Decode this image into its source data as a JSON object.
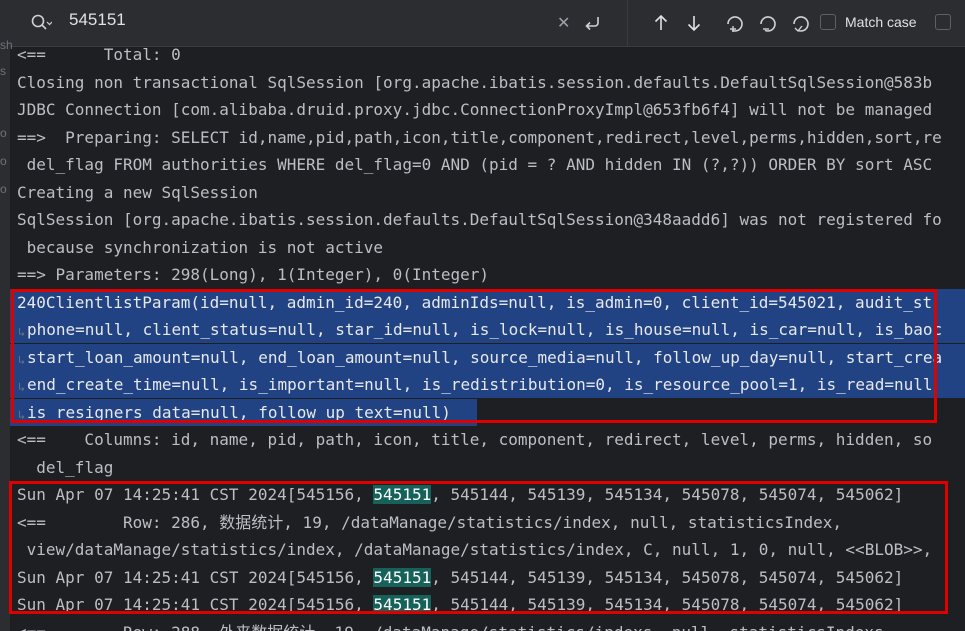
{
  "findbar": {
    "query": "545151",
    "match_case_label": "Match case"
  },
  "gutter_marks": [
    "sh",
    "s",
    "o",
    "o",
    "o"
  ],
  "console_lines": [
    {
      "text": "<==      Total: 0",
      "sel": false
    },
    {
      "text": "Closing non transactional SqlSession [org.apache.ibatis.session.defaults.DefaultSqlSession@583b",
      "sel": false
    },
    {
      "text": "JDBC Connection [com.alibaba.druid.proxy.jdbc.ConnectionProxyImpl@653fb6f4] will not be managed",
      "sel": false
    },
    {
      "text": "==>  Preparing: SELECT id,name,pid,path,icon,title,component,redirect,level,perms,hidden,sort,re",
      "sel": false
    },
    {
      "text": " del_flag FROM authorities WHERE del_flag=0 AND (pid = ? AND hidden IN (?,?)) ORDER BY sort ASC",
      "sel": false
    },
    {
      "text": "Creating a new SqlSession",
      "sel": false
    },
    {
      "text": "SqlSession [org.apache.ibatis.session.defaults.DefaultSqlSession@348aadd6] was not registered fo",
      "sel": false
    },
    {
      "text": " because synchronization is not active",
      "sel": false
    },
    {
      "text": "==> Parameters: 298(Long), 1(Integer), 0(Integer)",
      "sel": false
    },
    {
      "text": "240ClientlistParam(id=null, admin_id=240, adminIds=null, is_admin=0, client_id=545021, audit_st",
      "sel": true
    },
    {
      "text": "phone=null, client_status=null, star_id=null, is_lock=null, is_house=null, is_car=null, is_baoc",
      "sel": true
    },
    {
      "text": "start_loan_amount=null, end_loan_amount=null, source_media=null, follow_up_day=null, start_crea",
      "sel": true
    },
    {
      "text": "end_create_time=null, is_important=null, is_redistribution=0, is_resource_pool=1, is_read=null",
      "sel": true
    },
    {
      "text": "is_resigners_data=null, follow_up_text=null)",
      "sel": true
    },
    {
      "text": "<==    Columns: id, name, pid, path, icon, title, component, redirect, level, perms, hidden, so",
      "sel": false
    },
    {
      "text": "  del_flag",
      "sel": false
    },
    {
      "pre": "Sun Apr 07 14:25:41 CST 2024[545156, ",
      "hit": "545151",
      "post": ", 545144, 545139, 545134, 545078, 545074, 545062]",
      "sel": false
    },
    {
      "text": "<==        Row: 286, 数据统计, 19, /dataManage/statistics/index, null, statisticsIndex,",
      "sel": false
    },
    {
      "text": " view/dataManage/statistics/index, /dataManage/statistics/index, C, null, 1, 0, null, <<BLOB>>,",
      "sel": false
    },
    {
      "pre": "Sun Apr 07 14:25:41 CST 2024[545156, ",
      "hit": "545151",
      "post": ", 545144, 545139, 545134, 545078, 545074, 545062]",
      "sel": false
    },
    {
      "pre": "Sun Apr 07 14:25:41 CST 2024[545156, ",
      "hit": "545151",
      "post": ", 545144, 545139, 545134, 545078, 545074, 545062]",
      "sel": false
    },
    {
      "text": "<==        Row: 288, 外来数据统计, 19, /dataManage/statistics/indexs, null, statisticsIndexs,",
      "sel": false
    }
  ]
}
